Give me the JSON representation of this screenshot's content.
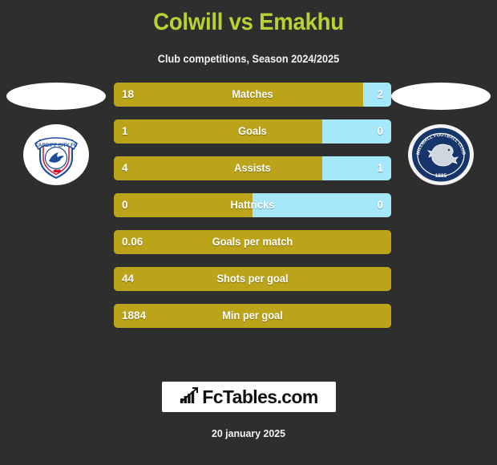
{
  "header": {
    "title": "Colwill vs Emakhu",
    "subtitle": "Club competitions, Season 2024/2025",
    "title_color": "#b5d334"
  },
  "home": {
    "club_name": "CARDIFF CITY FC",
    "crest_name": "cardiff-city-fc-crest",
    "photo_name": "player-photo-colwill"
  },
  "away": {
    "club_name": "MILLWALL FOOTBALL CLUB",
    "club_year": "1885",
    "crest_name": "millwall-fc-crest",
    "photo_name": "player-photo-emakhu"
  },
  "colors": {
    "background": "#2e2e2e",
    "home_bar": "#bca41a",
    "away_bar": "#a5e8fb",
    "title": "#b5d334",
    "text": "#ffffff"
  },
  "footer": {
    "brand": "FcTables.com",
    "brand_icon": "bar-chart-growth-icon",
    "date": "20 january 2025"
  },
  "chart_data": {
    "type": "bar",
    "title": "Colwill vs Emakhu",
    "subtitle": "Club competitions, Season 2024/2025",
    "orientation": "horizontal-diverging",
    "legend": [
      "Colwill",
      "Emakhu"
    ],
    "categories": [
      "Matches",
      "Goals",
      "Assists",
      "Hattricks",
      "Goals per match",
      "Shots per goal",
      "Min per goal"
    ],
    "series": [
      {
        "name": "Colwill",
        "color": "#bca41a",
        "values": [
          18,
          1,
          4,
          0,
          0.06,
          44,
          1884
        ],
        "labels": [
          "18",
          "1",
          "4",
          "0",
          "0.06",
          "44",
          "1884"
        ]
      },
      {
        "name": "Emakhu",
        "color": "#a5e8fb",
        "values": [
          2,
          0,
          1,
          0,
          null,
          null,
          null
        ],
        "labels": [
          "2",
          "0",
          "1",
          "0",
          "",
          "",
          ""
        ]
      }
    ],
    "rows": [
      {
        "label": "Matches",
        "home": "18",
        "away": "2",
        "home_pct": 90,
        "split": true
      },
      {
        "label": "Goals",
        "home": "1",
        "away": "0",
        "home_pct": 75,
        "split": true
      },
      {
        "label": "Assists",
        "home": "4",
        "away": "1",
        "home_pct": 75,
        "split": true
      },
      {
        "label": "Hattricks",
        "home": "0",
        "away": "0",
        "home_pct": 50,
        "split": true
      },
      {
        "label": "Goals per match",
        "home": "0.06",
        "away": "",
        "home_pct": 100,
        "split": false
      },
      {
        "label": "Shots per goal",
        "home": "44",
        "away": "",
        "home_pct": 100,
        "split": false
      },
      {
        "label": "Min per goal",
        "home": "1884",
        "away": "",
        "home_pct": 100,
        "split": false
      }
    ]
  }
}
